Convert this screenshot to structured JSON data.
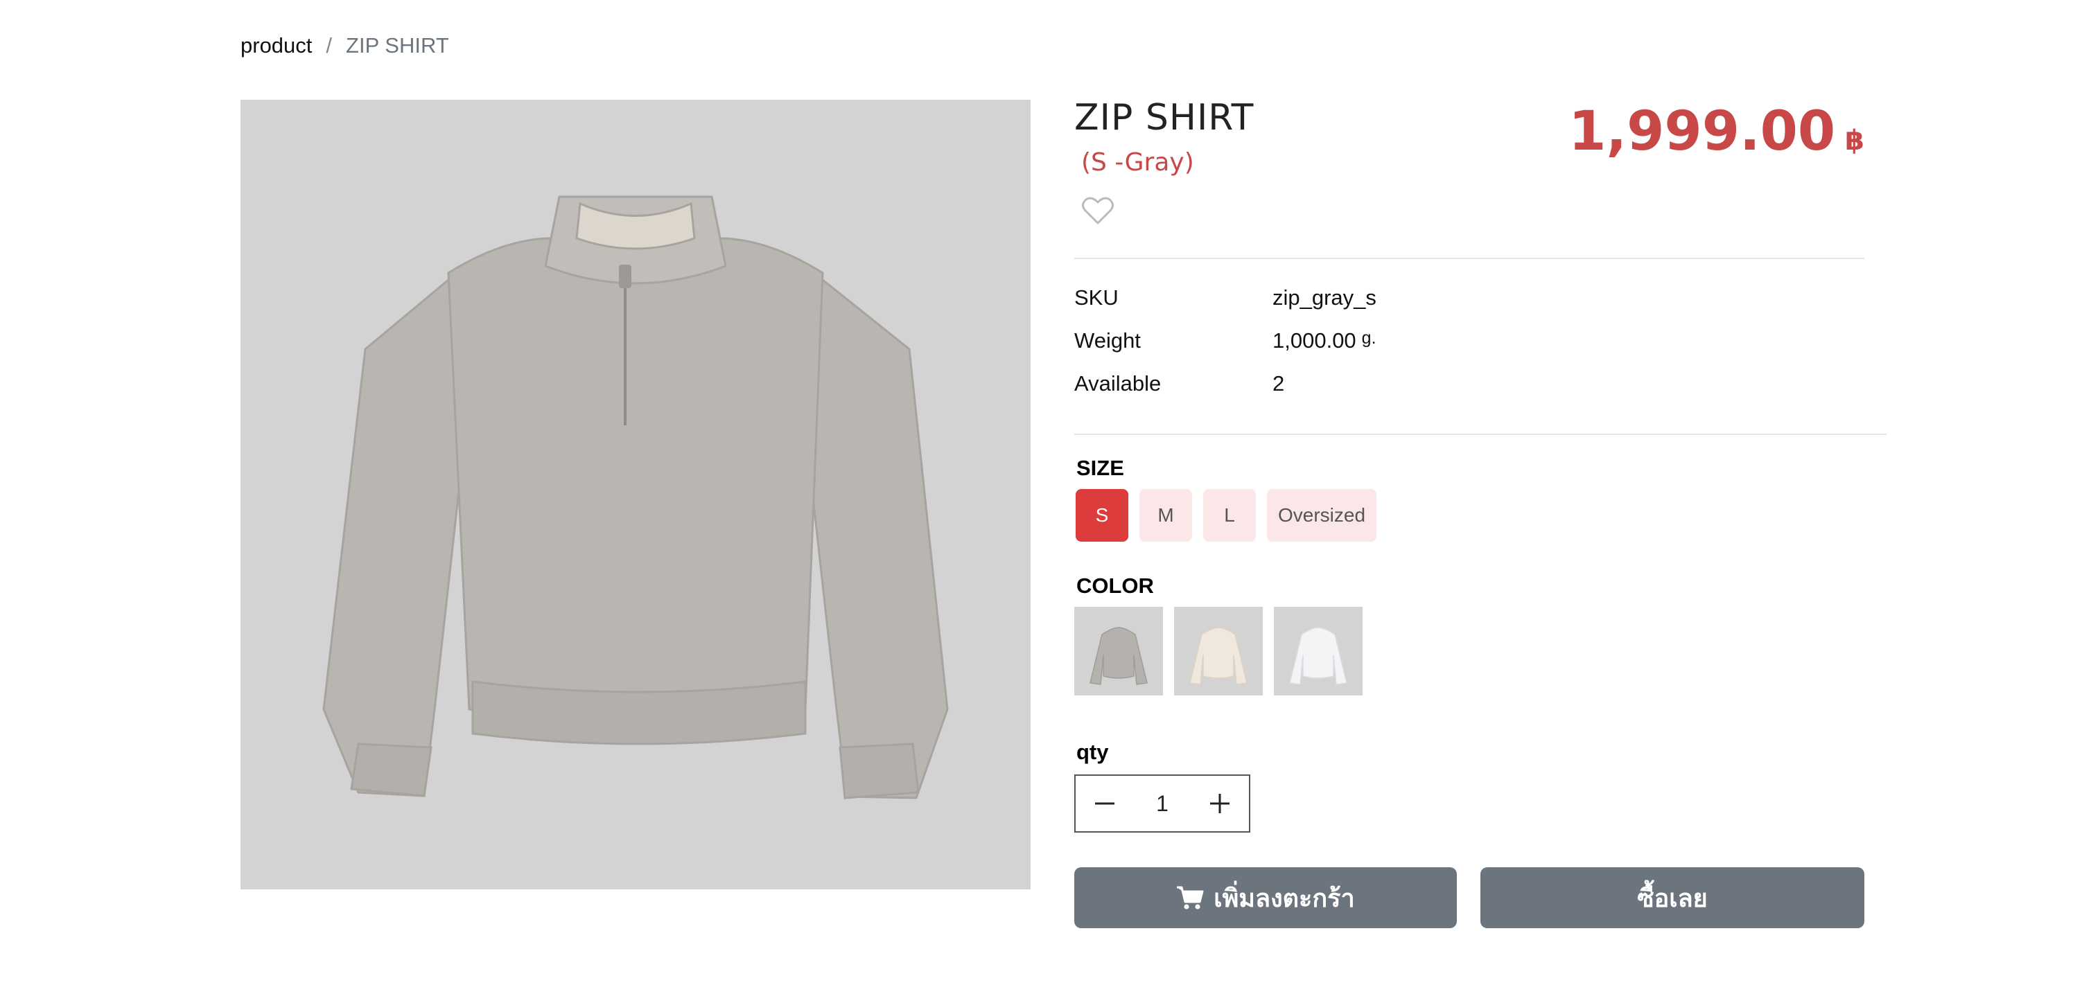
{
  "breadcrumb": {
    "root": "product",
    "separator": "/",
    "current": "ZIP SHIRT"
  },
  "product": {
    "title": "ZIP SHIRT",
    "variant": "(S -Gray)",
    "price": "1,999.00",
    "currency": "฿",
    "image_icon": "sweatshirt-image"
  },
  "attributes": [
    {
      "label": "SKU",
      "value": "zip_gray_s",
      "unit": ""
    },
    {
      "label": "Weight",
      "value": "1,000.00",
      "unit": "g."
    },
    {
      "label": "Available",
      "value": "2",
      "unit": ""
    }
  ],
  "size": {
    "label": "SIZE",
    "options": [
      "S",
      "M",
      "L",
      "Oversized"
    ],
    "selected": "S"
  },
  "color": {
    "label": "COLOR",
    "swatches": [
      {
        "name": "gray",
        "hex": "#b5b2ad"
      },
      {
        "name": "cream",
        "hex": "#f0e8dc"
      },
      {
        "name": "white",
        "hex": "#f4f4f6"
      }
    ]
  },
  "qty": {
    "label": "qty",
    "value": "1"
  },
  "actions": {
    "add_to_cart": "เพิ่มลงตะกร้า",
    "buy_now": "ซื้อเลย"
  },
  "colors": {
    "accent": "#c84848",
    "selected_size": "#dc3c3c",
    "size_bg": "#fbe7e7",
    "button": "#6c757d",
    "image_bg": "#d3d3d3"
  },
  "icons": {
    "wishlist": "heart-outline-icon",
    "cart": "cart-icon",
    "minus": "minus-icon",
    "plus": "plus-icon"
  }
}
